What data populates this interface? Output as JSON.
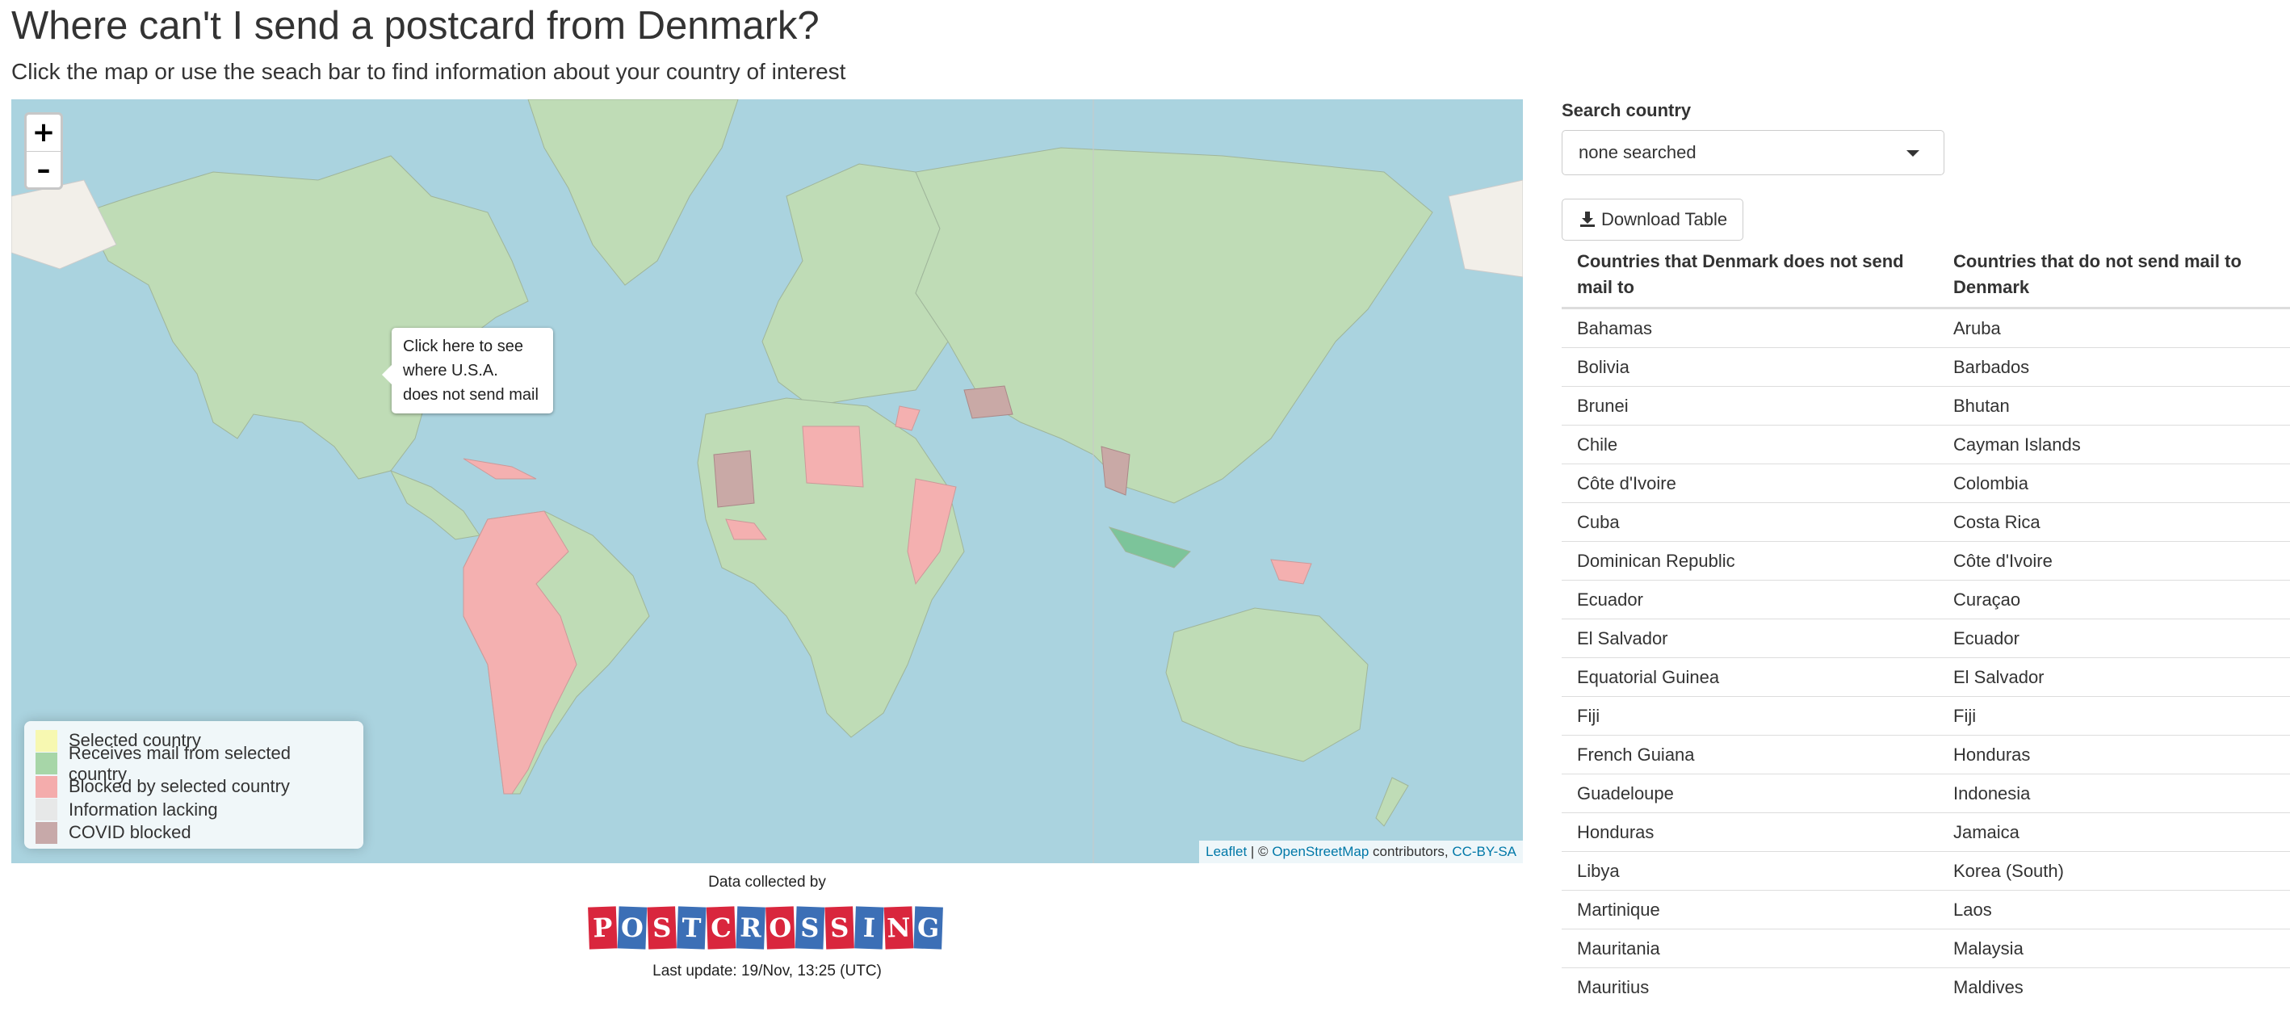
{
  "page": {
    "title": "Where can't I send a postcard from Denmark?",
    "subtitle": "Click the map or use the seach bar to find information about your country of interest"
  },
  "map": {
    "zoom_in": "+",
    "zoom_out": "–",
    "tooltip": [
      "Click here to see",
      "where U.S.A.",
      "does not send mail"
    ],
    "legend": [
      {
        "label": "Selected country",
        "color": "#f7f7a8"
      },
      {
        "label": "Receives mail from selected country",
        "color": "#9fd19f"
      },
      {
        "label": "Blocked by selected country",
        "color": "#f4a3a3"
      },
      {
        "label": "Information lacking",
        "color": "#e6e6e6"
      },
      {
        "label": "COVID blocked",
        "color": "#c2a0a0"
      }
    ],
    "attribution": {
      "leaflet": "Leaflet",
      "sep": " | © ",
      "osm": "OpenStreetMap",
      "contrib": " contributors, ",
      "license": "CC-BY-SA"
    },
    "colors": {
      "ocean": "#aad3df",
      "land": "#bfdcb6",
      "blocked": "#f4b0b0",
      "covid": "#c9a9a6",
      "arctic": "#f2efe9"
    }
  },
  "footer": {
    "collected_by": "Data collected by",
    "logo_text": "POSTCROSSING",
    "last_update": "Last update: 19/Nov, 13:25 (UTC)"
  },
  "sidebar": {
    "search_label": "Search country",
    "search_value": "none searched",
    "download_label": "Download Table"
  },
  "table": {
    "headers": [
      "Countries that Denmark does not send mail to",
      "Countries that do not send mail to Denmark"
    ],
    "rows": [
      [
        "Bahamas",
        "Aruba"
      ],
      [
        "Bolivia",
        "Barbados"
      ],
      [
        "Brunei",
        "Bhutan"
      ],
      [
        "Chile",
        "Cayman Islands"
      ],
      [
        "Côte d'Ivoire",
        "Colombia"
      ],
      [
        "Cuba",
        "Costa Rica"
      ],
      [
        "Dominican Republic",
        "Côte d'Ivoire"
      ],
      [
        "Ecuador",
        "Curaçao"
      ],
      [
        "El Salvador",
        "Ecuador"
      ],
      [
        "Equatorial Guinea",
        "El Salvador"
      ],
      [
        "Fiji",
        "Fiji"
      ],
      [
        "French Guiana",
        "Honduras"
      ],
      [
        "Guadeloupe",
        "Indonesia"
      ],
      [
        "Honduras",
        "Jamaica"
      ],
      [
        "Libya",
        "Korea (South)"
      ],
      [
        "Martinique",
        "Laos"
      ],
      [
        "Mauritania",
        "Malaysia"
      ],
      [
        "Mauritius",
        "Maldives"
      ]
    ]
  }
}
